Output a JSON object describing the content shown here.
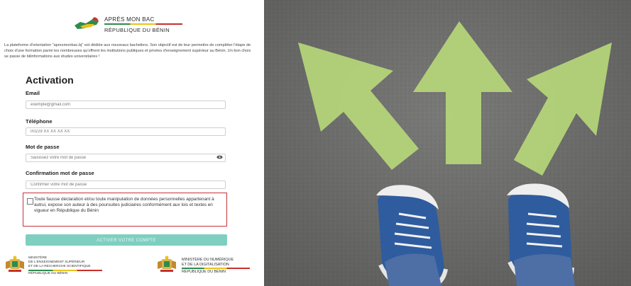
{
  "brand": {
    "line1": "APRÈS MON BAC",
    "line2": "RÉPUBLIQUE DU BÉNIN"
  },
  "intro": "La plateforme d'orientation \"apresmonbac.bj\" est dédiée aux nouveaux bacheliers. Son objectif est de leur permettre de compléter l'étape de choix d'une formation parmi les nombreuses qu'offrent les institutions publiques et privées d'enseignement supérieur au Bénin. Un bon choix se passe de bilinformations aux études universitaires !",
  "form": {
    "title": "Activation",
    "email_label": "Email",
    "email_placeholder": "exemple@gmail.com",
    "phone_label": "Téléphone",
    "phone_placeholder": "00229 XX XX XX XX",
    "password_label": "Mot de passe",
    "password_placeholder": "Saisissez votre mot de passe",
    "confirm_label": "Confirmation mot de passe",
    "confirm_placeholder": "Confirmer votre mot de passe",
    "consent_text": "Toute fausse déclaration et/ou toute manipulation de données personnelles appartenant à autrui, expose son auteur à des poursuites judiciaires conformément aux lois et textes en vigueur en République du Bénin",
    "submit_label": "ACTIVER VOTRE COMPTE"
  },
  "footer": {
    "left": {
      "line1": "MINISTÈRE",
      "line2": "DE L'ENSEIGNEMENT SUPÉRIEUR",
      "line3": "ET DE LA RECHERCHE SCIENTIFIQUE",
      "line4": "RÉPUBLIQUE DU BÉNIN"
    },
    "right": {
      "line1": "MINISTÈRE DU NUMÉRIQUE",
      "line2": "ET DE LA DIGITALISATION",
      "line3": "RÉPUBLIQUE DU BÉNIN"
    }
  },
  "colors": {
    "accent_button": "#7fcfc0",
    "consent_border": "#c8333c",
    "arrow_green": "#b6d77a",
    "asphalt": "#6d6d6b",
    "shoe_blue": "#2f5c9e"
  },
  "image": {
    "icon": "asphalt-arrows-sneakers-photo"
  }
}
